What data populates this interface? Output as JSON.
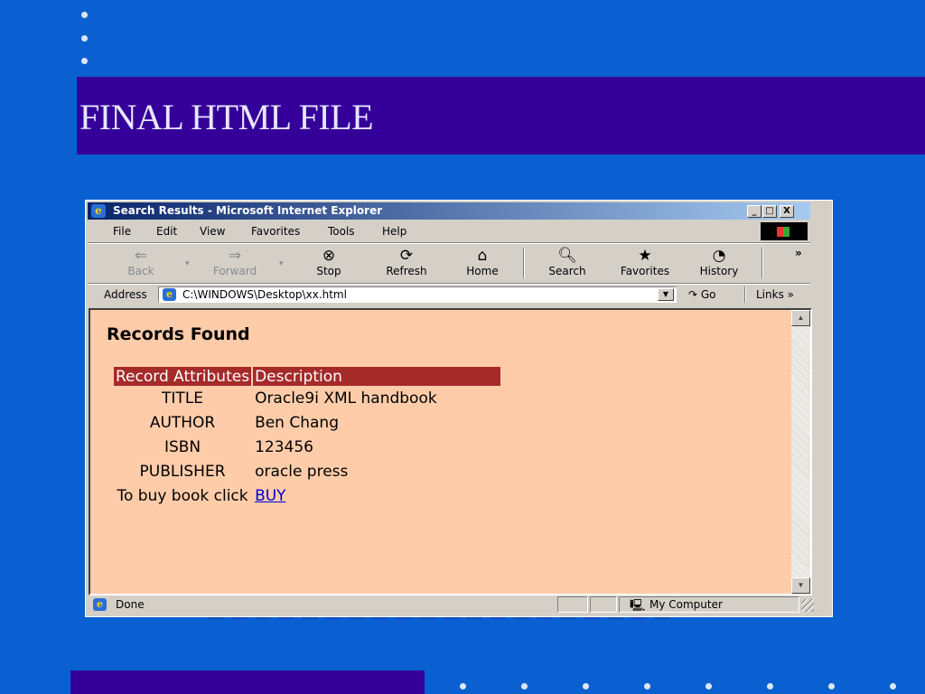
{
  "slide": {
    "title": "FINAL HTML FILE"
  },
  "window": {
    "title": "Search Results - Microsoft Internet Explorer",
    "minimize_glyph": "_",
    "maximize_glyph": "□",
    "close_glyph": "X"
  },
  "menu": {
    "items": [
      "File",
      "Edit",
      "View",
      "Favorites",
      "Tools",
      "Help"
    ]
  },
  "toolbar": {
    "back": "Back",
    "forward": "Forward",
    "stop": "Stop",
    "refresh": "Refresh",
    "home": "Home",
    "search": "Search",
    "favorites": "Favorites",
    "history": "History",
    "overflow": "»"
  },
  "address_bar": {
    "label": "Address",
    "url": "C:\\WINDOWS\\Desktop\\xx.html",
    "go": "Go",
    "links": "Links »"
  },
  "page": {
    "heading": "Records Found",
    "table": {
      "headers": [
        "Record Attributes",
        "Description"
      ],
      "rows": [
        {
          "attr": "TITLE",
          "value": "Oracle9i XML handbook"
        },
        {
          "attr": "AUTHOR",
          "value": "Ben Chang"
        },
        {
          "attr": "ISBN",
          "value": "123456"
        },
        {
          "attr": "PUBLISHER",
          "value": "oracle press"
        }
      ],
      "buy_label": "To buy book click",
      "buy_link": "BUY"
    }
  },
  "status": {
    "text": "Done",
    "zone": "My Computer"
  },
  "colors": {
    "slide_background": "#0a60d0",
    "title_band": "#350099",
    "page_background": "#ffccaa",
    "header_cell": "#a52a2a"
  }
}
